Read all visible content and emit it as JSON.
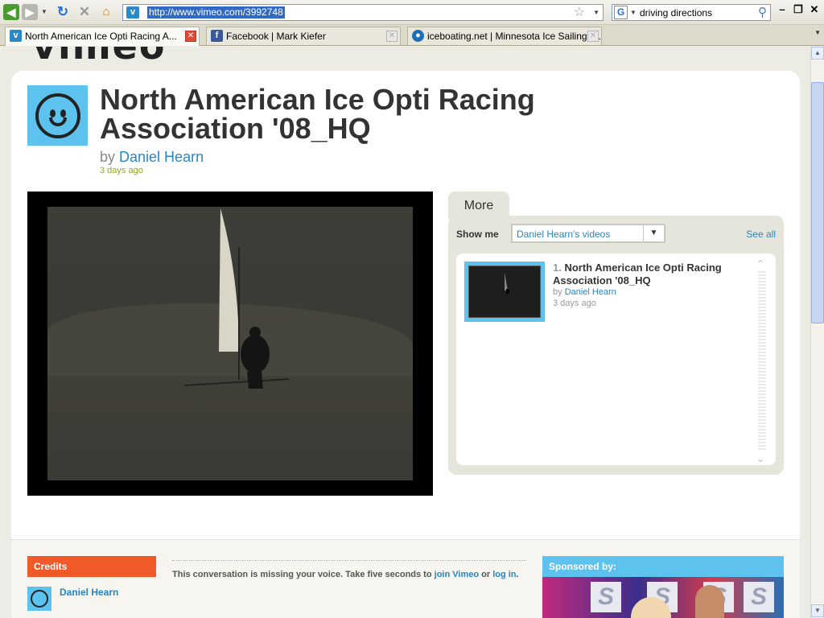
{
  "browser": {
    "url": "http://www.vimeo.com/3992748",
    "search_query": "driving directions",
    "tabs": [
      {
        "label": "North American Ice Opti Racing A...",
        "icon": "vimeo-icon"
      },
      {
        "label": "Facebook | Mark Kiefer",
        "icon": "facebook-icon"
      },
      {
        "label": "iceboating.net | Minnesota Ice Sailing A...",
        "icon": "drupal-icon"
      }
    ]
  },
  "video": {
    "title": "North American Ice Opti Racing Association '08_HQ",
    "by_prefix": "by",
    "author": "Daniel Hearn",
    "age": "3 days ago"
  },
  "more": {
    "tab_label": "More",
    "show_me_label": "Show me",
    "select_value": "Daniel Hearn's videos",
    "see_all": "See all",
    "items": [
      {
        "num": "1.",
        "title": "North American Ice Opti Racing Association '08_HQ",
        "by_prefix": "by",
        "author": "Daniel Hearn",
        "age": "3 days ago"
      }
    ]
  },
  "footer": {
    "credits_heading": "Credits",
    "credit_name": "Daniel Hearn",
    "conversation_text": "This conversation is missing your voice. Take five seconds to",
    "join_link": "join Vimeo",
    "or_text": "or",
    "login_link": "log in",
    "period": ".",
    "sponsor_heading": "Sponsored by:"
  },
  "colors": {
    "brand_blue": "#5ec2ee",
    "link": "#2786c2",
    "credits_orange": "#f05a28",
    "age_green": "#8aa92c"
  }
}
